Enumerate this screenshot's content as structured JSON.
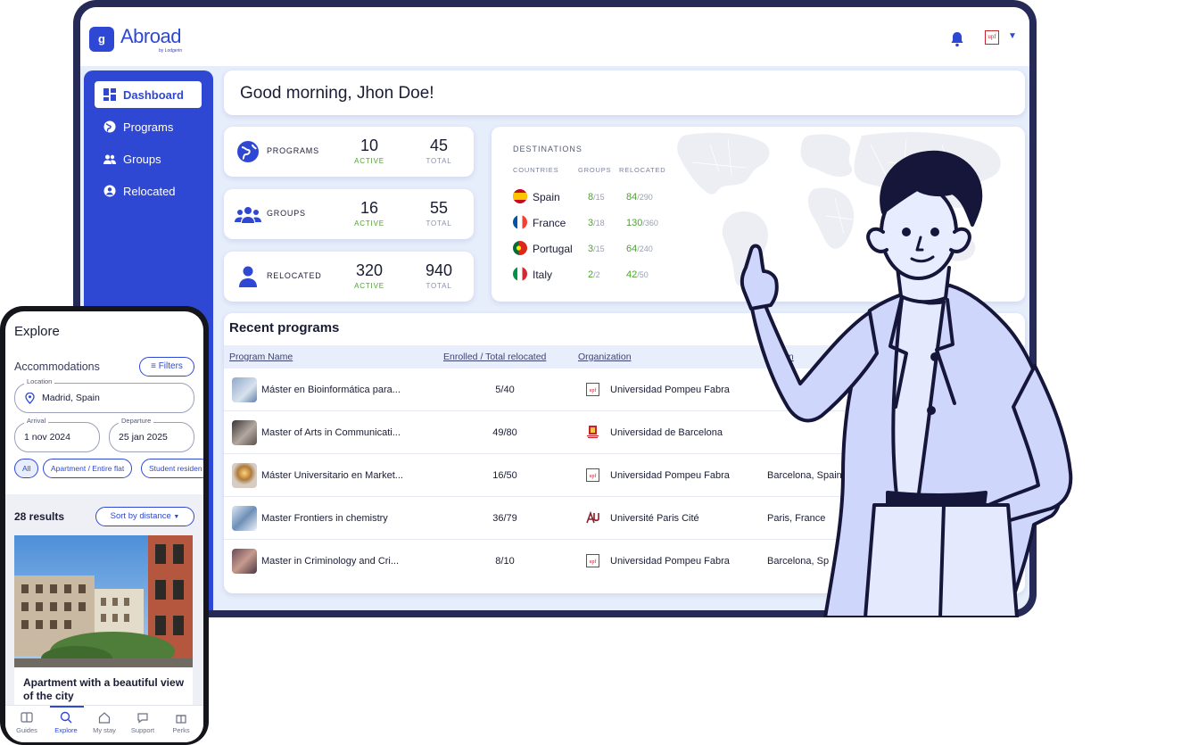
{
  "app": {
    "name": "Abroad",
    "byline": "by Lodgerin"
  },
  "header": {
    "org_logo_text": "upf"
  },
  "sidebar": {
    "items": [
      {
        "label": "Dashboard",
        "icon": "dashboard-icon",
        "active": true
      },
      {
        "label": "Programs",
        "icon": "globe-icon"
      },
      {
        "label": "Groups",
        "icon": "groups-icon"
      },
      {
        "label": "Relocated",
        "icon": "person-icon"
      }
    ]
  },
  "greeting": "Good morning, Jhon Doe!",
  "stats": [
    {
      "label": "PROGRAMS",
      "icon": "globe-icon",
      "active": "10",
      "active_label": "ACTIVE",
      "total": "45",
      "total_label": "TOTAL"
    },
    {
      "label": "GROUPS",
      "icon": "groups-icon",
      "active": "16",
      "active_label": "ACTIVE",
      "total": "55",
      "total_label": "TOTAL"
    },
    {
      "label": "RELOCATED",
      "icon": "person-icon",
      "active": "320",
      "active_label": "ACTIVE",
      "total": "940",
      "total_label": "TOTAL"
    }
  ],
  "destinations": {
    "title": "DESTINATIONS",
    "headers": {
      "countries": "COUNTRIES",
      "groups": "GROUPS",
      "relocated": "RELOCATED"
    },
    "rows": [
      {
        "country": "Spain",
        "groups": "8",
        "groups_total": "/15",
        "relocated": "84",
        "relocated_total": "/290",
        "flag": "spain-flag-icon"
      },
      {
        "country": "France",
        "groups": "3",
        "groups_total": "/18",
        "relocated": "130",
        "relocated_total": "/360",
        "flag": "france-flag-icon"
      },
      {
        "country": "Portugal",
        "groups": "3",
        "groups_total": "/15",
        "relocated": "64",
        "relocated_total": "/240",
        "flag": "portugal-flag-icon"
      },
      {
        "country": "Italy",
        "groups": "2",
        "groups_total": "/2",
        "relocated": "42",
        "relocated_total": "/50",
        "flag": "italy-flag-icon"
      }
    ]
  },
  "recent": {
    "title": "Recent programs",
    "headers": {
      "name": "Program Name",
      "enrolled": "Enrolled / Total relocated",
      "org": "Organization",
      "location": "ation"
    },
    "rows": [
      {
        "name": "Máster en Bioinformática para...",
        "enrolled": "5/40",
        "org": "Universidad Pompeu Fabra",
        "location": "",
        "org_logo": "upf-logo-icon"
      },
      {
        "name": "Master of Arts in Communicati...",
        "enrolled": "49/80",
        "org": "Universidad de Barcelona",
        "location": "",
        "org_logo": "ub-logo-icon"
      },
      {
        "name": "Máster Universitario en Market...",
        "enrolled": "16/50",
        "org": "Universidad Pompeu Fabra",
        "location": "Barcelona, Spain",
        "org_logo": "upf-logo-icon"
      },
      {
        "name": "Master Frontiers in chemistry",
        "enrolled": "36/79",
        "org": "Université Paris Cité",
        "location": "Paris, France",
        "org_logo": "upc-logo-icon"
      },
      {
        "name": "Master in Criminology and Cri...",
        "enrolled": "8/10",
        "org": "Universidad Pompeu Fabra",
        "location": "Barcelona, Sp",
        "org_logo": "upf-logo-icon"
      }
    ]
  },
  "phone": {
    "title": "Explore",
    "section": "Accommodations",
    "filters_label": "Filters",
    "location": {
      "label": "Location",
      "value": "Madrid, Spain"
    },
    "arrival": {
      "label": "Arrival",
      "value": "1 nov 2024"
    },
    "departure": {
      "label": "Departure",
      "value": "25 jan 2025"
    },
    "chips": [
      "All",
      "Apartment / Entire flat",
      "Student residen"
    ],
    "results": "28 results",
    "sort_label": "Sort by distance",
    "card_title": "Apartment with a beautiful view of the city",
    "tabs": [
      {
        "label": "Guides",
        "icon": "guides-icon"
      },
      {
        "label": "Explore",
        "icon": "explore-icon",
        "active": true
      },
      {
        "label": "My stay",
        "icon": "home-icon"
      },
      {
        "label": "Support",
        "icon": "chat-icon"
      },
      {
        "label": "Perks",
        "icon": "gift-icon"
      }
    ]
  },
  "colors": {
    "primary": "#2f48d3",
    "navy": "#262a57",
    "green": "#4ca32f",
    "background": "#e6edfb"
  }
}
